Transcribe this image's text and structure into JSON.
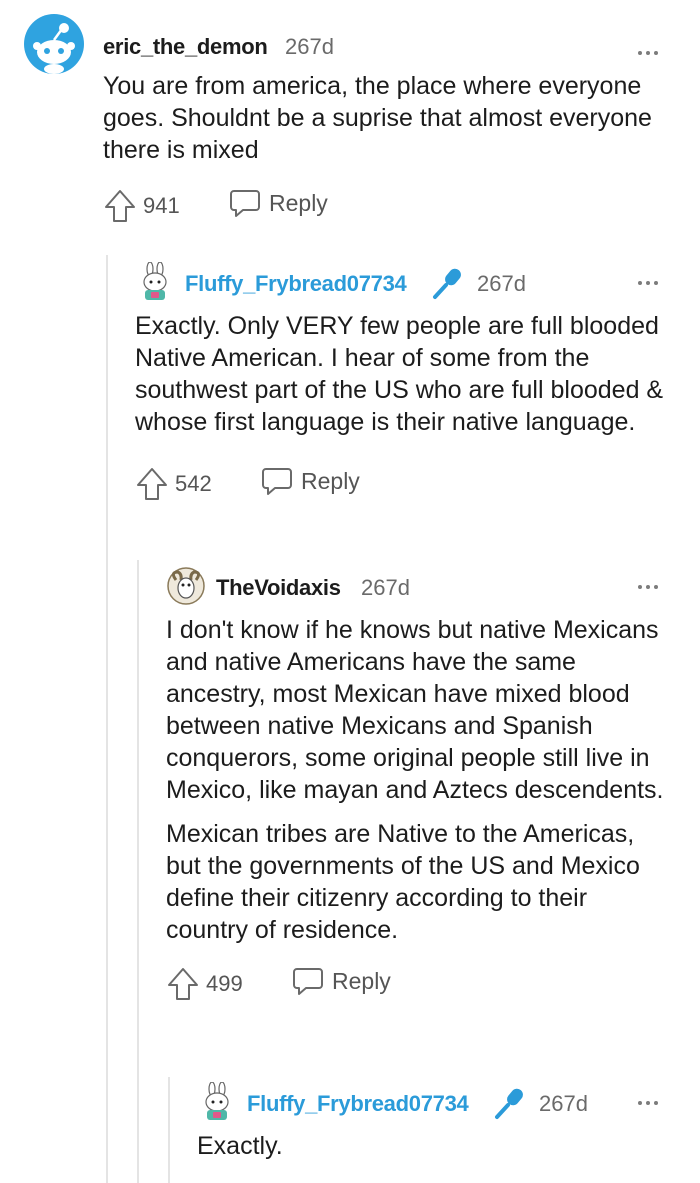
{
  "colors": {
    "mod_username": "#2b9bd9",
    "thread_line": "#e4e4e4",
    "meta": "#6a6a6a"
  },
  "comments": [
    {
      "author": "eric_the_demon",
      "age": "267d",
      "avatar_icon": "snoo-avatar-icon",
      "paragraphs": [
        "You are from america, the place where everyone goes. Shouldnt be a suprise that almost everyone there is mixed"
      ],
      "votes": "941",
      "reply_label": "Reply"
    },
    {
      "author": "Fluffy_Frybread07734",
      "age": "267d",
      "avatar_icon": "bunny-avatar-icon",
      "badge_icon": "microphone-icon",
      "paragraphs": [
        "Exactly. Only VERY few people are full blooded Native American. I hear of some from the southwest part of the US who are full blooded & whose first language is their native language."
      ],
      "votes": "542",
      "reply_label": "Reply"
    },
    {
      "author": "TheVoidaxis",
      "age": "267d",
      "avatar_icon": "ram-avatar-icon",
      "paragraphs": [
        "I don't know if he knows but native Mexicans and native Americans have the same ancestry, most Mexican have mixed blood between native Mexicans and Spanish conquerors, some original people still live in Mexico, like mayan and Aztecs descendents.",
        "Mexican tribes are Native to the Americas, but the governments of the US and Mexico define their citizenry according to their country of residence."
      ],
      "votes": "499",
      "reply_label": "Reply"
    },
    {
      "author": "Fluffy_Frybread07734",
      "age": "267d",
      "avatar_icon": "bunny-avatar-icon",
      "badge_icon": "microphone-icon",
      "paragraphs": [
        "Exactly."
      ]
    }
  ]
}
